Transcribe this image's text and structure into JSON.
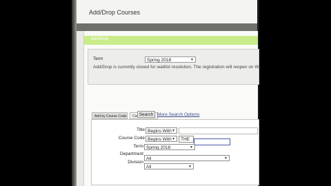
{
  "page": {
    "title": "Add/Drop Courses"
  },
  "adddrop": {
    "label": "Add/Drop"
  },
  "term_section": {
    "label": "Term",
    "selected": "Spring 2018",
    "message": "Add/Drop is currently closed for waitlist resolution. The registration will reopen on W"
  },
  "tabs": [
    {
      "label": "Add by Course Code"
    },
    {
      "label": "Course Search"
    }
  ],
  "search": {
    "title_label": "Title",
    "title_mode": "Begins With",
    "code_label": "Course Code",
    "code_mode": "Begins With",
    "code_value": "THE",
    "term_label": "Term",
    "term_value": "Spring 2018",
    "dept_label": "Department",
    "dept_value": "All",
    "div_label": "Division",
    "div_value": "All",
    "search_button": "Search",
    "more_options": "More Search Options"
  }
}
